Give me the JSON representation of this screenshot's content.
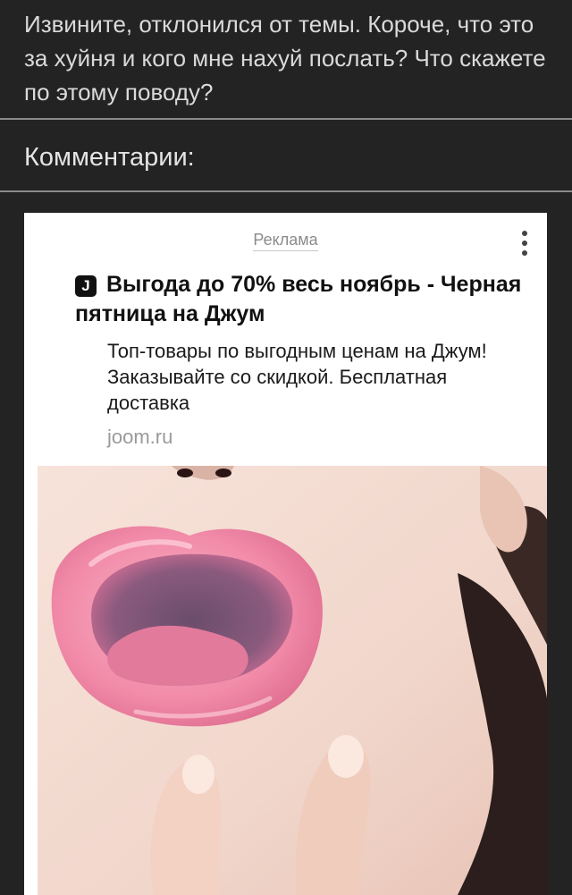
{
  "post": {
    "text": "Извините, отклонился от темы. Короче, что это за хуйня и кого мне нахуй послать? Что скажете по этому поводу?"
  },
  "comments": {
    "title": "Комментарии:"
  },
  "ad": {
    "label": "Реклама",
    "brand_icon_letter": "J",
    "headline": "Выгода до 70% весь ноябрь - Черная пятница на Джум",
    "description": "Топ-товары по выгодным ценам на Джум! Заказывайте со скидкой. Бесплатная доставка",
    "domain": "joom.ru",
    "menu_icon": "kebab-menu-icon",
    "image_subject": "ad-photo-lips-mouth"
  },
  "colors": {
    "background": "#232323",
    "card": "#ffffff",
    "text_light": "#dadada",
    "divider": "#8a8a8a",
    "lip_pink": "#f08aa8"
  }
}
